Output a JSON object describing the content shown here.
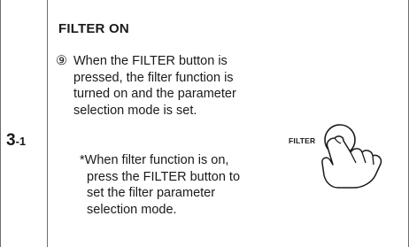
{
  "step": {
    "number": "3",
    "sub": "-1"
  },
  "section": {
    "heading": "FILTER ON"
  },
  "item": {
    "marker": "⑨",
    "text": "When the FILTER button is\npressed, the filter function is\nturned on and the parameter\nselection mode is set."
  },
  "note": {
    "first": "*When filter function is on,",
    "rest": "press the FILTER button to\nset the filter parameter\nselection mode."
  },
  "illustration": {
    "label": "FILTER",
    "icon": "hand-pressing-button-icon"
  }
}
